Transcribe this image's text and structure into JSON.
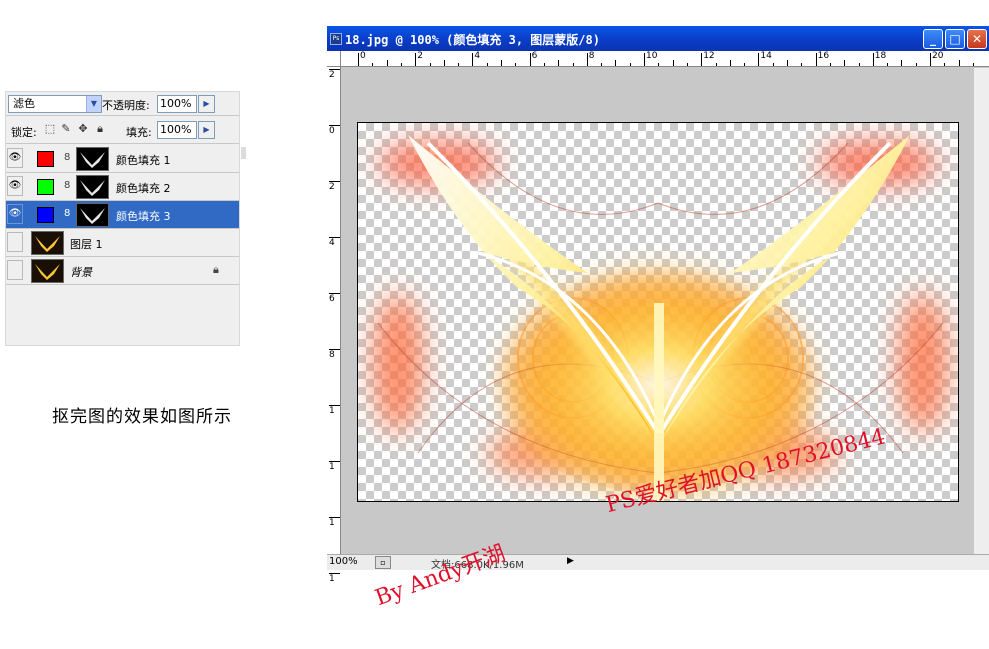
{
  "layers_panel": {
    "blend_mode": "滤色",
    "opacity_label": "不透明度:",
    "opacity_value": "100%",
    "lock_label": "锁定:",
    "fill_label": "填充:",
    "fill_value": "100%",
    "lock_icons": [
      "transparent-lock-icon",
      "brush-lock-icon",
      "move-lock-icon",
      "padlock-icon"
    ],
    "layers": [
      {
        "name": "颜色填充 1",
        "type": "fill",
        "color": "#ff0000",
        "visible": true,
        "selected": false
      },
      {
        "name": "颜色填充 2",
        "type": "fill",
        "color": "#00ff00",
        "visible": true,
        "selected": false
      },
      {
        "name": "颜色填充 3",
        "type": "fill",
        "color": "#0000ff",
        "visible": true,
        "selected": true
      },
      {
        "name": "图层 1",
        "type": "image",
        "visible": false,
        "selected": false
      },
      {
        "name": "背景",
        "type": "background",
        "visible": false,
        "selected": false,
        "locked": true
      }
    ]
  },
  "caption": "抠完图的效果如图所示",
  "document": {
    "title": "18.jpg @ 100% (颜色填充 3, 图层蒙版/8)",
    "window_buttons": [
      "minimize-button",
      "maximize-button",
      "close-button"
    ],
    "ruler_top_labels": [
      "0",
      "2",
      "4",
      "6",
      "8",
      "10",
      "12",
      "14",
      "16",
      "18",
      "20"
    ],
    "ruler_left_labels": [
      "2",
      "0",
      "2",
      "4",
      "6",
      "8",
      "1",
      "1",
      "1",
      "1"
    ],
    "zoom": "100%",
    "doc_info": "文档:668.0K/1.96M",
    "accent_color": "#0a3dc7"
  },
  "watermarks": {
    "qq": "PS爱好者加QQ 187320844",
    "author": "By Andy开湖"
  }
}
